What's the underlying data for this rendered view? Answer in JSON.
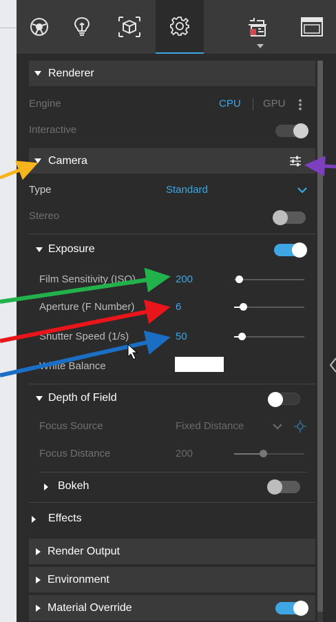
{
  "tabs": [
    {
      "icon": "globe-icon"
    },
    {
      "icon": "lightbulb-icon"
    },
    {
      "icon": "cube-icon"
    },
    {
      "icon": "gear-icon",
      "active": true
    },
    {
      "icon": "scene-icon"
    },
    {
      "icon": "window-icon"
    }
  ],
  "renderer": {
    "title": "Renderer",
    "engine_label": "Engine",
    "cpu": "CPU",
    "gpu": "GPU",
    "interactive_label": "Interactive",
    "interactive_on": true
  },
  "camera": {
    "title": "Camera",
    "type_label": "Type",
    "type_value": "Standard",
    "stereo_label": "Stereo",
    "stereo_on": false
  },
  "exposure": {
    "title": "Exposure",
    "enabled": true,
    "film_label": "Film Sensitivity (ISO)",
    "film_value": "200",
    "aperture_label": "Aperture (F Number)",
    "aperture_value": "6",
    "shutter_label": "Shutter Speed (1/s)",
    "shutter_value": "50",
    "wb_label": "White Balance",
    "wb_color": "#ffffff"
  },
  "dof": {
    "title": "Depth of Field",
    "enabled": false,
    "focus_source_label": "Focus Source",
    "focus_source_value": "Fixed Distance",
    "focus_distance_label": "Focus Distance",
    "focus_distance_value": "200",
    "bokeh_title": "Bokeh",
    "bokeh_on": false
  },
  "sections": {
    "effects": "Effects",
    "render_output": "Render Output",
    "environment": "Environment",
    "material_override": "Material Override"
  },
  "colors": {
    "accent": "#3ea6e3",
    "arrow_yellow": "#f6b51f",
    "arrow_purple": "#7b3fbf",
    "arrow_green": "#22b24c",
    "arrow_red": "#e8151b",
    "arrow_blue": "#1a6fc4"
  }
}
